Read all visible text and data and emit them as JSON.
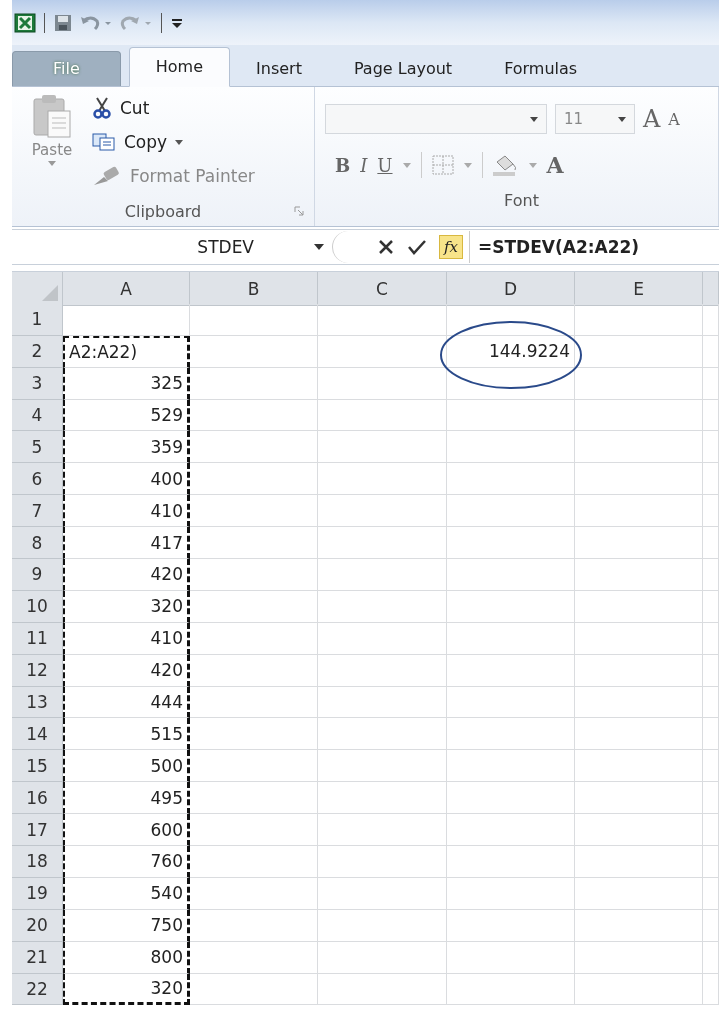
{
  "tabs": [
    {
      "label": "File",
      "kind": "file",
      "selected": false
    },
    {
      "label": "Home",
      "kind": "tab",
      "selected": true
    },
    {
      "label": "Insert",
      "kind": "tab",
      "selected": false
    },
    {
      "label": "Page Layout",
      "kind": "tab",
      "selected": false
    },
    {
      "label": "Formulas",
      "kind": "tab",
      "selected": false
    }
  ],
  "clipboard": {
    "paste": "Paste",
    "cut": "Cut",
    "copy": "Copy",
    "format_painter": "Format Painter",
    "label": "Clipboard"
  },
  "font": {
    "size": "11",
    "grow": "A",
    "shrink": "A",
    "bold": "B",
    "italic": "I",
    "underline": "U",
    "font_color": "A",
    "label": "Font"
  },
  "formula_bar": {
    "name_box": "STDEV",
    "fx": "fx",
    "formula": "=STDEV(A2:A22)"
  },
  "columns": [
    "A",
    "B",
    "C",
    "D",
    "E"
  ],
  "rows": [
    {
      "number": "1",
      "marquee": false
    },
    {
      "number": "2",
      "marquee": true,
      "A": {
        "text": "A2:A22)",
        "kind": "editing"
      },
      "D": {
        "text": "144.9224",
        "circled": true
      }
    },
    {
      "number": "3",
      "marquee": true,
      "A": {
        "text": "325",
        "kind": "number"
      }
    },
    {
      "number": "4",
      "marquee": true,
      "A": {
        "text": "529",
        "kind": "number"
      }
    },
    {
      "number": "5",
      "marquee": true,
      "A": {
        "text": "359",
        "kind": "number"
      }
    },
    {
      "number": "6",
      "marquee": true,
      "A": {
        "text": "400",
        "kind": "number"
      }
    },
    {
      "number": "7",
      "marquee": true,
      "A": {
        "text": "410",
        "kind": "number"
      }
    },
    {
      "number": "8",
      "marquee": true,
      "A": {
        "text": "417",
        "kind": "number"
      }
    },
    {
      "number": "9",
      "marquee": true,
      "A": {
        "text": "420",
        "kind": "number"
      }
    },
    {
      "number": "10",
      "marquee": true,
      "A": {
        "text": "320",
        "kind": "number"
      }
    },
    {
      "number": "11",
      "marquee": true,
      "A": {
        "text": "410",
        "kind": "number"
      }
    },
    {
      "number": "12",
      "marquee": true,
      "A": {
        "text": "420",
        "kind": "number"
      }
    },
    {
      "number": "13",
      "marquee": true,
      "A": {
        "text": "444",
        "kind": "number"
      }
    },
    {
      "number": "14",
      "marquee": true,
      "A": {
        "text": "515",
        "kind": "number"
      }
    },
    {
      "number": "15",
      "marquee": true,
      "A": {
        "text": "500",
        "kind": "number"
      }
    },
    {
      "number": "16",
      "marquee": true,
      "A": {
        "text": "495",
        "kind": "number"
      }
    },
    {
      "number": "17",
      "marquee": true,
      "A": {
        "text": "600",
        "kind": "number"
      }
    },
    {
      "number": "18",
      "marquee": true,
      "A": {
        "text": "760",
        "kind": "number"
      }
    },
    {
      "number": "19",
      "marquee": true,
      "A": {
        "text": "540",
        "kind": "number"
      }
    },
    {
      "number": "20",
      "marquee": true,
      "A": {
        "text": "750",
        "kind": "number"
      }
    },
    {
      "number": "21",
      "marquee": true,
      "A": {
        "text": "800",
        "kind": "number"
      }
    },
    {
      "number": "22",
      "marquee": true,
      "A": {
        "text": "320",
        "kind": "number"
      }
    }
  ]
}
